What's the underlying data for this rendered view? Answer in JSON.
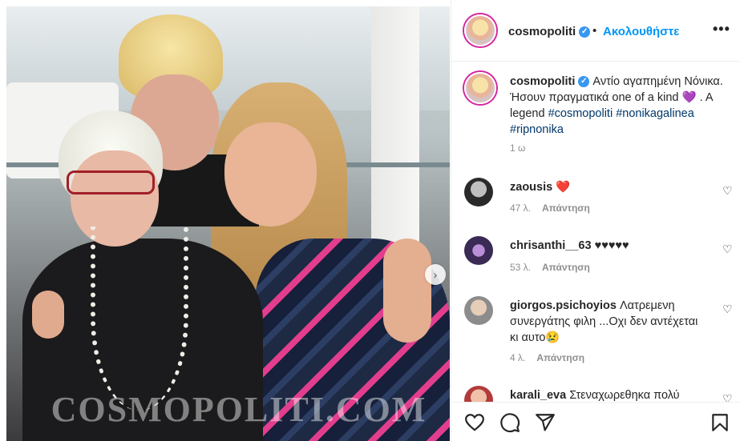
{
  "post": {
    "image_alt": "Three people posing together",
    "watermark": "COSMOPOLITI.COM"
  },
  "header": {
    "username": "cosmopoliti",
    "verified": "✓",
    "separator": "•",
    "follow_label": "Ακολουθήστε",
    "more_label": "•••"
  },
  "caption": {
    "username": "cosmopoliti",
    "verified": "✓",
    "text_part1": "Αντίο αγαπημένη Νόνικα. Ήσουν πραγματικά one of a kind",
    "heart": "💜",
    "text_part2": ". A legend",
    "hashtag1": "#cosmopoliti",
    "hashtag2": "#nonikagalinea",
    "hashtag3": "#ripnonika",
    "time": "1 ω"
  },
  "comments": [
    {
      "username": "zaousis",
      "text": "❤️",
      "time": "47 λ.",
      "reply": "Απάντηση"
    },
    {
      "username": "chrisanthi__63",
      "text": "♥♥♥♥♥",
      "time": "53 λ.",
      "reply": "Απάντηση"
    },
    {
      "username": "giorgos.psichoyios",
      "text": "Λατρεμενη συνεργάτης φιλη ...Οχι δεν αντέχεται κι αυτο😢",
      "time": "4 λ.",
      "reply": "Απάντηση"
    },
    {
      "username": "karali_eva",
      "text": "Στεναχωρεθηκα πολύ"
    }
  ],
  "icons": {
    "like": "heart-outline-icon",
    "comment": "comment-bubble-icon",
    "share": "paper-plane-icon",
    "save": "bookmark-icon",
    "comment_like": "♡",
    "next": "›"
  }
}
